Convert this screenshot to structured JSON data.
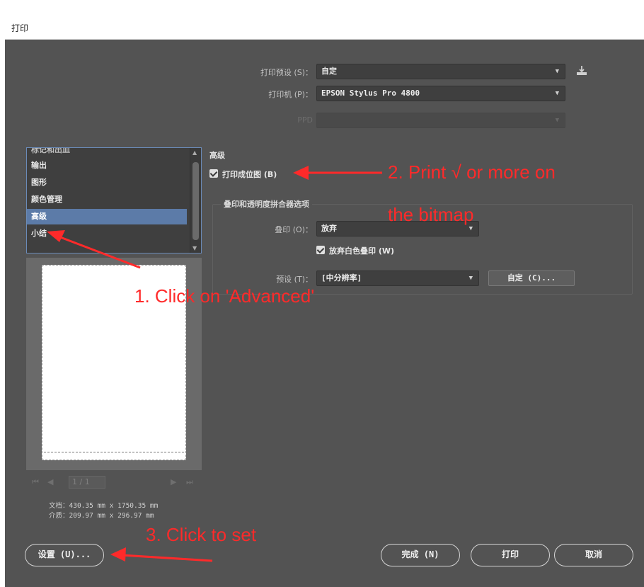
{
  "window": {
    "title": "打印"
  },
  "fields": {
    "preset": {
      "label": "打印预设 (S)：",
      "value": "自定"
    },
    "printer": {
      "label": "打印机 (P)：",
      "value": "EPSON Stylus Pro 4800"
    },
    "ppd": {
      "label": "PPD",
      "value": ""
    }
  },
  "categories": {
    "partial_item": "标记和出血",
    "items": [
      "输出",
      "图形",
      "颜色管理",
      "高级",
      "小结"
    ],
    "selected": "高级"
  },
  "advanced": {
    "section_title": "高级",
    "print_as_bitmap": {
      "label": "打印成位图 (B)",
      "checked": true
    },
    "flattener_group": {
      "title": "叠印和透明度拼合器选项",
      "overprint": {
        "label": "叠印 (O)：",
        "value": "放弃"
      },
      "discard_white": {
        "label": "放弃白色叠印 (W)",
        "checked": true
      },
      "preset": {
        "label": "预设 (T)：",
        "value": "[中分辨率]"
      },
      "custom_button": "自定 (C)..."
    }
  },
  "page_nav": {
    "first": "⏮",
    "prev": "◀",
    "page": "1 / 1",
    "next": "▶",
    "last": "⏭"
  },
  "doc_info": {
    "document": "文档：430.35 mm x 1750.35 mm",
    "media": "介质：209.97 mm x 296.97 mm"
  },
  "buttons": {
    "setup": "设置 (U)...",
    "done": "完成 (N)",
    "print": "打印",
    "cancel": "取消"
  },
  "annotations": {
    "step1": "1. Click on 'Advanced'",
    "step2_line1": "2. Print √ or more on",
    "step2_line2": "the bitmap",
    "step3": "3. Click to set"
  },
  "colors": {
    "dialog_bg": "#535353",
    "selection": "#5c7ba8",
    "annotation": "#ff2a2a"
  }
}
